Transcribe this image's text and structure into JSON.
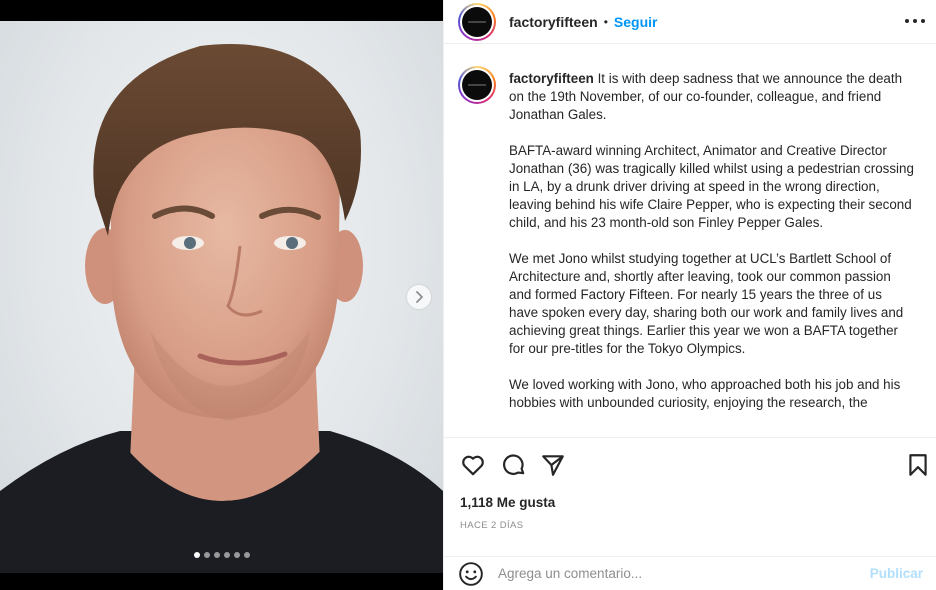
{
  "post": {
    "author": "factoryfifteen",
    "separator": "•",
    "follow_label": "Seguir",
    "caption_paragraphs": [
      "It is with deep sadness that we announce the death on the 19th November, of our co-founder, colleague, and friend Jonathan Gales.",
      "BAFTA-award winning Architect, Animator and Creative Director Jonathan (36) was tragically killed whilst using a pedestrian crossing in LA, by a drunk driver driving at speed in the wrong direction, leaving behind his wife Claire Pepper, who is expecting their second child, and his 23 month-old son Finley Pepper Gales.",
      "We met Jono whilst studying together at UCL’s Bartlett School of Architecture and, shortly after leaving, took our common passion and formed Factory Fifteen. For nearly 15 years the three of us have spoken every day, sharing both our work and family lives and achieving great things. Earlier this year we won a BAFTA together for our pre-titles for the Tokyo Olympics.",
      "We loved working with Jono, who approached both his job and his hobbies with unbounded curiosity, enjoying the research, the"
    ],
    "likes_text": "1,118 Me gusta",
    "time_text": "HACE 2 DÍAS",
    "comment_placeholder": "Agrega un comentario...",
    "publish_label": "Publicar"
  },
  "carousel": {
    "total": 6,
    "active_index": 0
  },
  "icons": {
    "next": "chevron-right-icon",
    "more": "more-options-icon",
    "like": "heart-icon",
    "comment": "comment-bubble-icon",
    "share": "paper-plane-icon",
    "save": "bookmark-icon",
    "emoji": "smiley-icon"
  },
  "colors": {
    "accent": "#0095f6",
    "publish_disabled": "#b2dffc",
    "secondary_text": "#8e8e8e"
  }
}
